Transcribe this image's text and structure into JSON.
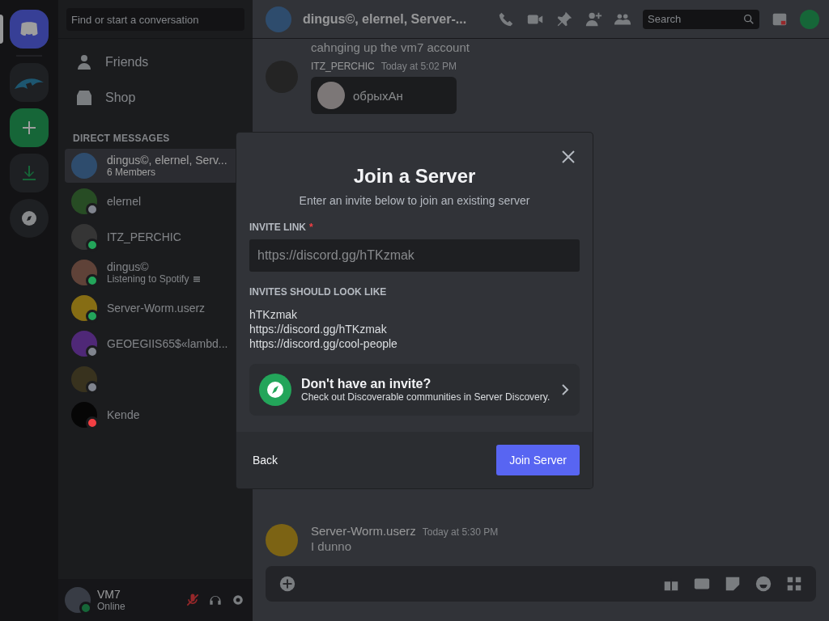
{
  "dm_search": {
    "placeholder": "Find or start a conversation"
  },
  "nav": [
    {
      "label": "Friends",
      "kind": "friends"
    },
    {
      "label": "Shop",
      "kind": "shop"
    }
  ],
  "dm_header": "DIRECT MESSAGES",
  "dms": [
    {
      "name": "dingus©, elernel, Serv...",
      "subtitle": "6 Members",
      "kind": "group",
      "selected": true
    },
    {
      "name": "elernel",
      "kind": "user",
      "color": "#80848e",
      "selected": false
    },
    {
      "name": "ITZ_PERCHIC",
      "kind": "user",
      "color": "#23a55a",
      "selected": false
    },
    {
      "name": "dingus©",
      "subtitle": "Listening to Spotify",
      "kind": "user",
      "color": "#23a55a",
      "selected": false
    },
    {
      "name": "Server-Worm.userz",
      "kind": "user",
      "color": "#23a55a",
      "selected": false
    },
    {
      "name": "GEOEGIIS65$«lambd...",
      "kind": "user",
      "color": "#80848e",
      "selected": false
    },
    {
      "kind": "user",
      "color": "#80848e",
      "selected": false
    },
    {
      "name": "Kende",
      "kind": "user",
      "color": "#f23f43",
      "selected": false
    }
  ],
  "user": {
    "name": "VM7",
    "status": "Online",
    "mic_muted": true
  },
  "chat": {
    "title": "dingus©, elernel, Server-...",
    "search": {
      "placeholder": "Search"
    },
    "top_messages": [
      {
        "kind": "continuation",
        "text": "cahnging up the vm7 account"
      },
      {
        "kind": "sticker",
        "author": "ITZ_PERCHIC",
        "time": "Today at 5:02 PM",
        "text": "обрыхАн"
      }
    ],
    "bottom_messages": [
      {
        "kind": "message",
        "author": "Server-Worm.userz",
        "time": "Today at 5:30 PM",
        "text": "I dunno"
      }
    ]
  },
  "modal": {
    "title": "Join a Server",
    "subtitle": "Enter an invite below to join an existing server",
    "invite_label": "INVITE LINK",
    "required_mark": "*",
    "input": {
      "placeholder": "https://discord.gg/hTKzmak"
    },
    "examples_label": "INVITES SHOULD LOOK LIKE",
    "examples": [
      "hTKzmak",
      "https://discord.gg/hTKzmak",
      "https://discord.gg/cool-people"
    ],
    "discovery": {
      "title": "Don't have an invite?",
      "subtitle": "Check out Discoverable communities in Server Discovery."
    },
    "back": "Back",
    "submit": "Join Server"
  }
}
